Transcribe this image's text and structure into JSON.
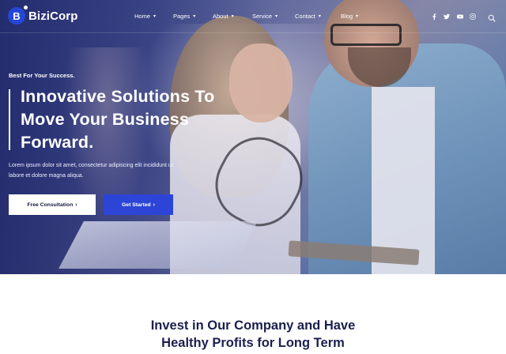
{
  "brand": {
    "initial": "B",
    "name": "BiziCorp",
    "color": "#2447d8"
  },
  "nav": {
    "items": [
      {
        "label": "Home"
      },
      {
        "label": "Pages"
      },
      {
        "label": "About"
      },
      {
        "label": "Service"
      },
      {
        "label": "Contact"
      },
      {
        "label": "Blog"
      }
    ],
    "socials": [
      "facebook-icon",
      "twitter-icon",
      "youtube-icon",
      "instagram-icon"
    ],
    "search_icon": "search-icon"
  },
  "hero": {
    "kicker": "Best For Your Success.",
    "headline": "Innovative Solutions To Move Your Business Forward.",
    "description": "Lorem ipsum dolor sit amet, consectetur adipiscing elit incididunt ut labore et dolore magna aliqua.",
    "primary_button": "Free Consultation",
    "secondary_button": "Get Started",
    "accent_color": "#2c45d6"
  },
  "section": {
    "title_line1": "Invest in Our Company and Have",
    "title_line2": "Healthy Profits for Long Term"
  }
}
